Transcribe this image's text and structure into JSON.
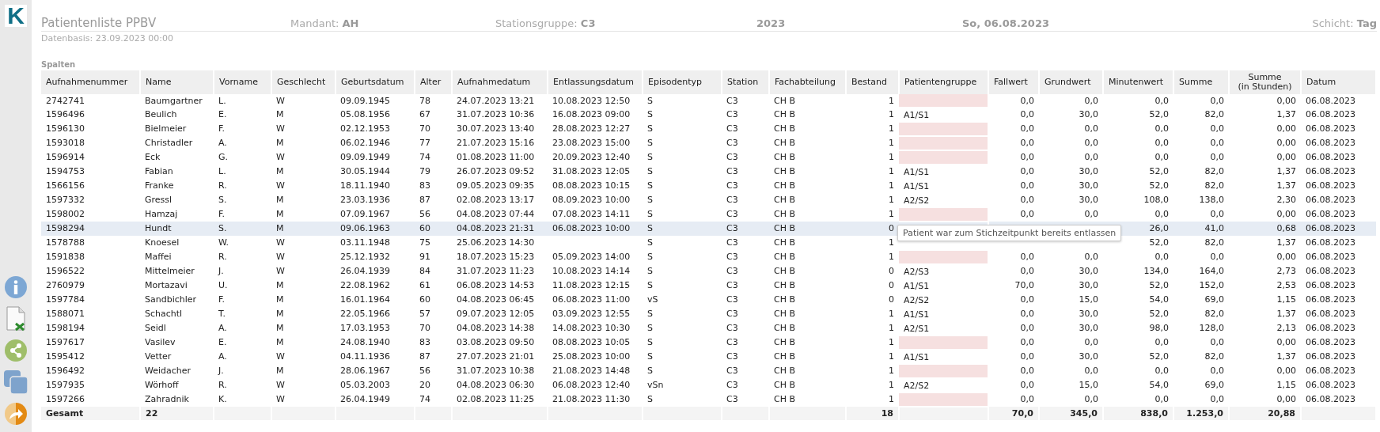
{
  "logo": "K",
  "header": {
    "title": "Patientenliste PPBV",
    "fields": [
      {
        "label": "Mandant:",
        "value": "AH"
      },
      {
        "label": "Stationsgruppe:",
        "value": "C3"
      },
      {
        "value": "2023"
      },
      {
        "value": "So, 06.08.2023"
      },
      {
        "label": "Schicht:",
        "value": "Tag"
      }
    ],
    "basis": "Datenbasis: 23.09.2023 00:00"
  },
  "section_label": "Spalten",
  "table": {
    "columns": [
      "Aufnahmenummer",
      "Name",
      "Vorname",
      "Geschlecht",
      "Geburtsdatum",
      "Alter",
      "Aufnahmedatum",
      "Entlassungsdatum",
      "Episodentyp",
      "Station",
      "Fachabteilung",
      "Bestand",
      "Patientengruppe",
      "Fallwert",
      "Grundwert",
      "Minutenwert",
      "Summe",
      "Summe\n(in Stunden)",
      "Datum"
    ],
    "rows": [
      {
        "selected": false,
        "group_missing": true,
        "nr": "2742741",
        "name": "Baumgartner",
        "vorname": "L.",
        "sex": "W",
        "born": "09.09.1945",
        "age": "78",
        "admit": "24.07.2023 13:21",
        "discharge": "10.08.2023 12:50",
        "episode": "S",
        "station": "C3",
        "dept": "CH B",
        "stock": "1",
        "fall": "0,0",
        "grund": "0,0",
        "minuten": "0,0",
        "summe": "0,0",
        "stunden": "0,00",
        "datum": "06.08.2023"
      },
      {
        "selected": false,
        "group_missing": false,
        "nr": "1596496",
        "name": "Beulich",
        "vorname": "E.",
        "sex": "M",
        "born": "05.08.1956",
        "age": "67",
        "admit": "31.07.2023 10:36",
        "discharge": "16.08.2023 09:00",
        "episode": "S",
        "station": "C3",
        "dept": "CH B",
        "stock": "1",
        "group": "A1/S1",
        "fall": "0,0",
        "grund": "30,0",
        "minuten": "52,0",
        "summe": "82,0",
        "stunden": "1,37",
        "datum": "06.08.2023"
      },
      {
        "selected": false,
        "group_missing": true,
        "nr": "1596130",
        "name": "Bielmeier",
        "vorname": "F.",
        "sex": "W",
        "born": "02.12.1953",
        "age": "70",
        "admit": "30.07.2023 13:40",
        "discharge": "28.08.2023 12:27",
        "episode": "S",
        "station": "C3",
        "dept": "CH B",
        "stock": "1",
        "fall": "0,0",
        "grund": "0,0",
        "minuten": "0,0",
        "summe": "0,0",
        "stunden": "0,00",
        "datum": "06.08.2023"
      },
      {
        "selected": false,
        "group_missing": true,
        "nr": "1593018",
        "name": "Christadler",
        "vorname": "A.",
        "sex": "M",
        "born": "06.02.1946",
        "age": "77",
        "admit": "21.07.2023 15:16",
        "discharge": "23.08.2023 15:00",
        "episode": "S",
        "station": "C3",
        "dept": "CH B",
        "stock": "1",
        "fall": "0,0",
        "grund": "0,0",
        "minuten": "0,0",
        "summe": "0,0",
        "stunden": "0,00",
        "datum": "06.08.2023"
      },
      {
        "selected": false,
        "group_missing": true,
        "nr": "1596914",
        "name": "Eck",
        "vorname": "G.",
        "sex": "W",
        "born": "09.09.1949",
        "age": "74",
        "admit": "01.08.2023 11:00",
        "discharge": "20.09.2023 12:40",
        "episode": "S",
        "station": "C3",
        "dept": "CH B",
        "stock": "1",
        "fall": "0,0",
        "grund": "0,0",
        "minuten": "0,0",
        "summe": "0,0",
        "stunden": "0,00",
        "datum": "06.08.2023"
      },
      {
        "selected": false,
        "group_missing": false,
        "nr": "1594753",
        "name": "Fabian",
        "vorname": "L.",
        "sex": "M",
        "born": "30.05.1944",
        "age": "79",
        "admit": "26.07.2023 09:52",
        "discharge": "31.08.2023 12:05",
        "episode": "S",
        "station": "C3",
        "dept": "CH B",
        "stock": "1",
        "group": "A1/S1",
        "fall": "0,0",
        "grund": "30,0",
        "minuten": "52,0",
        "summe": "82,0",
        "stunden": "1,37",
        "datum": "06.08.2023"
      },
      {
        "selected": false,
        "group_missing": false,
        "nr": "1566156",
        "name": "Franke",
        "vorname": "R.",
        "sex": "W",
        "born": "18.11.1940",
        "age": "83",
        "admit": "09.05.2023 09:35",
        "discharge": "08.08.2023 10:15",
        "episode": "S",
        "station": "C3",
        "dept": "CH B",
        "stock": "1",
        "group": "A1/S1",
        "fall": "0,0",
        "grund": "30,0",
        "minuten": "52,0",
        "summe": "82,0",
        "stunden": "1,37",
        "datum": "06.08.2023"
      },
      {
        "selected": false,
        "group_missing": false,
        "nr": "1597332",
        "name": "Gressl",
        "vorname": "S.",
        "sex": "M",
        "born": "23.03.1936",
        "age": "87",
        "admit": "02.08.2023 13:17",
        "discharge": "08.09.2023 10:00",
        "episode": "S",
        "station": "C3",
        "dept": "CH B",
        "stock": "1",
        "group": "A2/S2",
        "fall": "0,0",
        "grund": "30,0",
        "minuten": "108,0",
        "summe": "138,0",
        "stunden": "2,30",
        "datum": "06.08.2023"
      },
      {
        "selected": false,
        "group_missing": true,
        "nr": "1598002",
        "name": "Hamzaj",
        "vorname": "F.",
        "sex": "M",
        "born": "07.09.1967",
        "age": "56",
        "admit": "04.08.2023 07:44",
        "discharge": "07.08.2023 14:11",
        "episode": "S",
        "station": "C3",
        "dept": "CH B",
        "stock": "1",
        "fall": "0,0",
        "grund": "0,0",
        "minuten": "0,0",
        "summe": "0,0",
        "stunden": "0,00",
        "datum": "06.08.2023"
      },
      {
        "selected": true,
        "group_missing": false,
        "tooltip": "Patient war zum Stichzeitpunkt bereits entlassen",
        "nr": "1598294",
        "name": "Hundt",
        "vorname": "S.",
        "sex": "M",
        "born": "09.06.1963",
        "age": "60",
        "admit": "04.08.2023 21:31",
        "discharge": "06.08.2023 10:00",
        "episode": "S",
        "station": "C3",
        "dept": "CH B",
        "stock": "0",
        "minuten": "26,0",
        "summe": "41,0",
        "stunden": "0,68",
        "datum": "06.08.2023"
      },
      {
        "selected": false,
        "group_missing": false,
        "nr": "1578788",
        "name": "Knoesel",
        "vorname": "W.",
        "sex": "W",
        "born": "03.11.1948",
        "age": "75",
        "admit": "25.06.2023 14:30",
        "episode": "S",
        "station": "C3",
        "dept": "CH B",
        "stock": "1",
        "minuten": "52,0",
        "summe": "82,0",
        "stunden": "1,37",
        "datum": "06.08.2023"
      },
      {
        "selected": false,
        "group_missing": true,
        "nr": "1591838",
        "name": "Maffei",
        "vorname": "R.",
        "sex": "W",
        "born": "25.12.1932",
        "age": "91",
        "admit": "18.07.2023 15:23",
        "discharge": "05.09.2023 14:00",
        "episode": "S",
        "station": "C3",
        "dept": "CH B",
        "stock": "1",
        "fall": "0,0",
        "grund": "0,0",
        "minuten": "0,0",
        "summe": "0,0",
        "stunden": "0,00",
        "datum": "06.08.2023"
      },
      {
        "selected": false,
        "group_missing": false,
        "nr": "1596522",
        "name": "Mittelmeier",
        "vorname": "J.",
        "sex": "W",
        "born": "26.04.1939",
        "age": "84",
        "admit": "31.07.2023 11:23",
        "discharge": "10.08.2023 14:14",
        "episode": "S",
        "station": "C3",
        "dept": "CH B",
        "stock": "0",
        "group": "A2/S3",
        "fall": "0,0",
        "grund": "30,0",
        "minuten": "134,0",
        "summe": "164,0",
        "stunden": "2,73",
        "datum": "06.08.2023"
      },
      {
        "selected": false,
        "group_missing": false,
        "nr": "2760979",
        "name": "Mortazavi",
        "vorname": "U.",
        "sex": "M",
        "born": "22.08.1962",
        "age": "61",
        "admit": "06.08.2023 14:53",
        "discharge": "11.08.2023 12:15",
        "episode": "S",
        "station": "C3",
        "dept": "CH B",
        "stock": "0",
        "group": "A1/S1",
        "fall": "70,0",
        "grund": "30,0",
        "minuten": "52,0",
        "summe": "152,0",
        "stunden": "2,53",
        "datum": "06.08.2023"
      },
      {
        "selected": false,
        "group_missing": false,
        "nr": "1597784",
        "name": "Sandbichler",
        "vorname": "F.",
        "sex": "M",
        "born": "16.01.1964",
        "age": "60",
        "admit": "04.08.2023 06:45",
        "discharge": "06.08.2023 11:00",
        "episode": "vS",
        "station": "C3",
        "dept": "CH B",
        "stock": "0",
        "group": "A2/S2",
        "fall": "0,0",
        "grund": "15,0",
        "minuten": "54,0",
        "summe": "69,0",
        "stunden": "1,15",
        "datum": "06.08.2023"
      },
      {
        "selected": false,
        "group_missing": false,
        "nr": "1588071",
        "name": "Schachtl",
        "vorname": "T.",
        "sex": "M",
        "born": "22.05.1966",
        "age": "57",
        "admit": "09.07.2023 12:05",
        "discharge": "03.09.2023 12:55",
        "episode": "S",
        "station": "C3",
        "dept": "CH B",
        "stock": "1",
        "group": "A1/S1",
        "fall": "0,0",
        "grund": "30,0",
        "minuten": "52,0",
        "summe": "82,0",
        "stunden": "1,37",
        "datum": "06.08.2023"
      },
      {
        "selected": false,
        "group_missing": false,
        "nr": "1598194",
        "name": "Seidl",
        "vorname": "A.",
        "sex": "M",
        "born": "17.03.1953",
        "age": "70",
        "admit": "04.08.2023 14:38",
        "discharge": "14.08.2023 10:30",
        "episode": "S",
        "station": "C3",
        "dept": "CH B",
        "stock": "1",
        "group": "A2/S1",
        "fall": "0,0",
        "grund": "30,0",
        "minuten": "98,0",
        "summe": "128,0",
        "stunden": "2,13",
        "datum": "06.08.2023"
      },
      {
        "selected": false,
        "group_missing": true,
        "nr": "1597617",
        "name": "Vasilev",
        "vorname": "E.",
        "sex": "M",
        "born": "24.08.1940",
        "age": "83",
        "admit": "03.08.2023 09:50",
        "discharge": "08.08.2023 10:05",
        "episode": "S",
        "station": "C3",
        "dept": "CH B",
        "stock": "1",
        "fall": "0,0",
        "grund": "0,0",
        "minuten": "0,0",
        "summe": "0,0",
        "stunden": "0,00",
        "datum": "06.08.2023"
      },
      {
        "selected": false,
        "group_missing": false,
        "nr": "1595412",
        "name": "Vetter",
        "vorname": "A.",
        "sex": "W",
        "born": "04.11.1936",
        "age": "87",
        "admit": "27.07.2023 21:01",
        "discharge": "25.08.2023 10:00",
        "episode": "S",
        "station": "C3",
        "dept": "CH B",
        "stock": "1",
        "group": "A1/S1",
        "fall": "0,0",
        "grund": "30,0",
        "minuten": "52,0",
        "summe": "82,0",
        "stunden": "1,37",
        "datum": "06.08.2023"
      },
      {
        "selected": false,
        "group_missing": true,
        "nr": "1596492",
        "name": "Weidacher",
        "vorname": "J.",
        "sex": "M",
        "born": "28.06.1967",
        "age": "56",
        "admit": "31.07.2023 10:38",
        "discharge": "21.08.2023 14:48",
        "episode": "S",
        "station": "C3",
        "dept": "CH B",
        "stock": "1",
        "fall": "0,0",
        "grund": "0,0",
        "minuten": "0,0",
        "summe": "0,0",
        "stunden": "0,00",
        "datum": "06.08.2023"
      },
      {
        "selected": false,
        "group_missing": false,
        "nr": "1597935",
        "name": "Wörhoff",
        "vorname": "R.",
        "sex": "W",
        "born": "05.03.2003",
        "age": "20",
        "admit": "04.08.2023 06:30",
        "discharge": "06.08.2023 12:40",
        "episode": "vSn",
        "station": "C3",
        "dept": "CH B",
        "stock": "1",
        "group": "A2/S2",
        "fall": "0,0",
        "grund": "15,0",
        "minuten": "54,0",
        "summe": "69,0",
        "stunden": "1,15",
        "datum": "06.08.2023"
      },
      {
        "selected": false,
        "group_missing": true,
        "nr": "1597266",
        "name": "Zahradnik",
        "vorname": "K.",
        "sex": "W",
        "born": "26.04.1949",
        "age": "74",
        "admit": "02.08.2023 11:25",
        "discharge": "21.08.2023 11:30",
        "episode": "S",
        "station": "C3",
        "dept": "CH B",
        "stock": "1",
        "fall": "0,0",
        "grund": "0,0",
        "minuten": "0,0",
        "summe": "0,0",
        "stunden": "0,00",
        "datum": "06.08.2023"
      }
    ],
    "footer": {
      "nr": "Gesamt",
      "name": "22",
      "stock": "18",
      "fall": "70,0",
      "grund": "345,0",
      "minuten": "838,0",
      "summe": "1.253,0",
      "stunden": "20,88"
    }
  }
}
